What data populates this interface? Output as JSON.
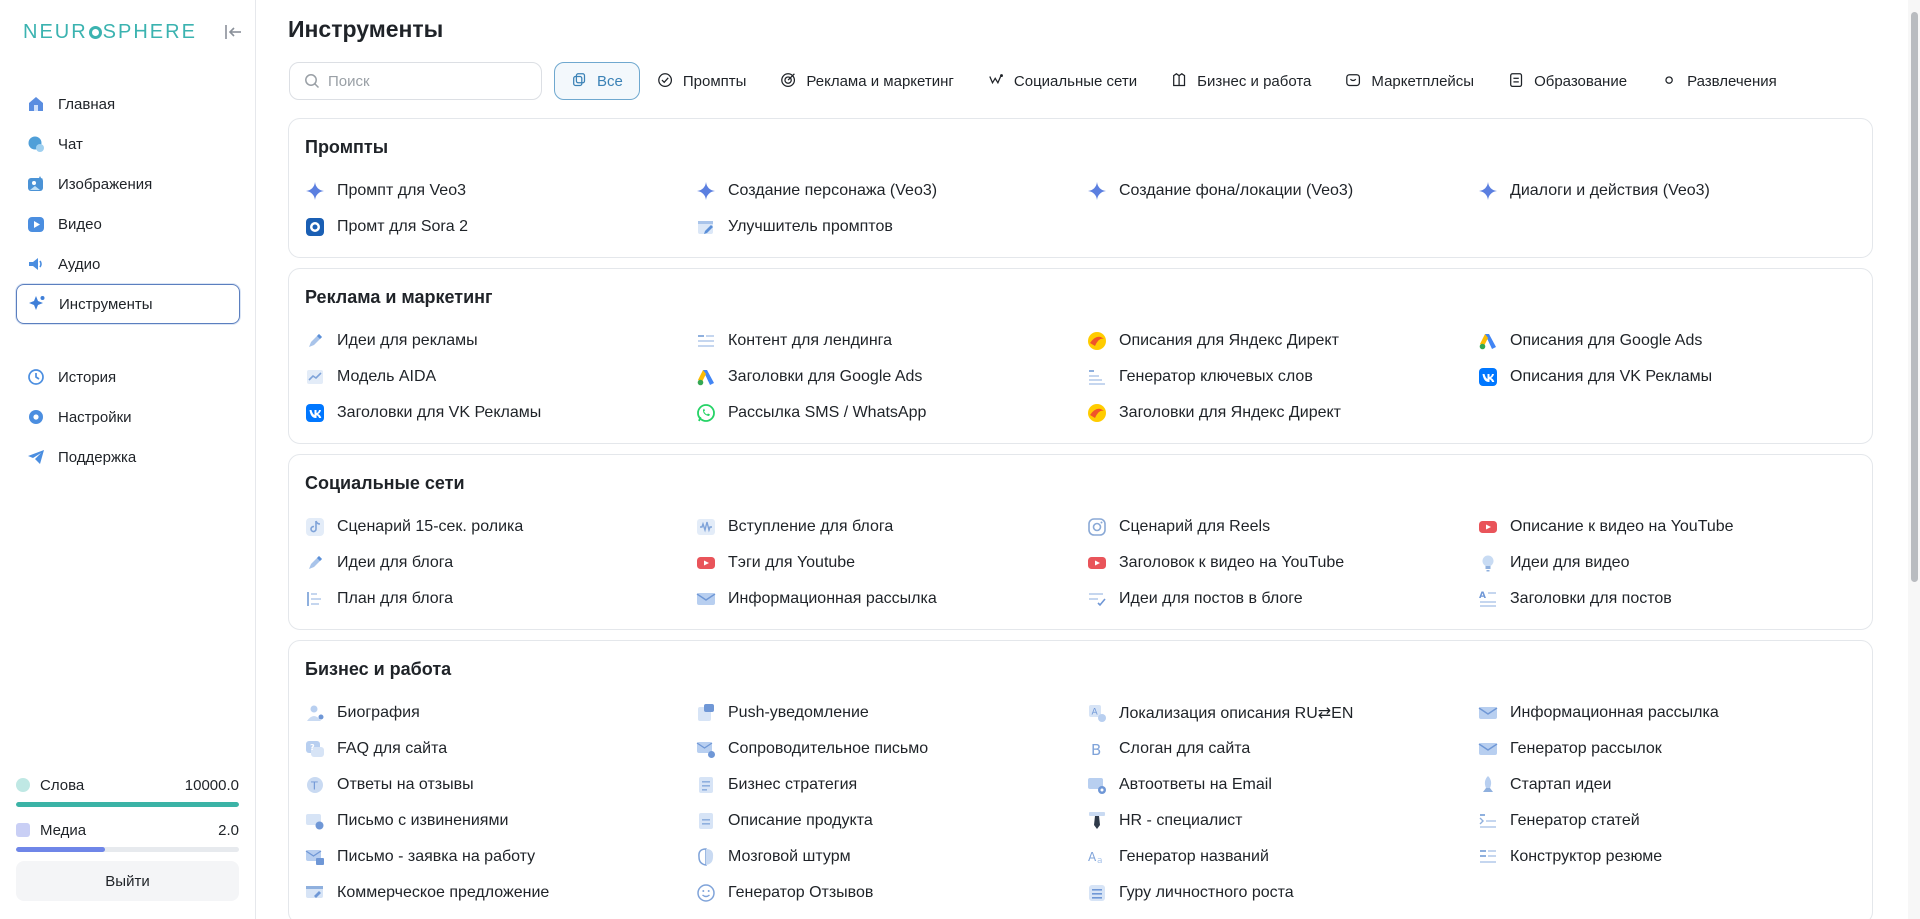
{
  "brand": {
    "logo_left": "NEUR",
    "logo_right": "SPHERE"
  },
  "nav": {
    "items": [
      {
        "label": "Главная",
        "icon": "home-icon"
      },
      {
        "label": "Чат",
        "icon": "chat-icon"
      },
      {
        "label": "Изображения",
        "icon": "image-icon"
      },
      {
        "label": "Видео",
        "icon": "video-icon"
      },
      {
        "label": "Аудио",
        "icon": "audio-icon"
      },
      {
        "label": "Инструменты",
        "icon": "sparkle-icon",
        "active": true
      }
    ],
    "secondary": [
      {
        "label": "История",
        "icon": "history-icon"
      },
      {
        "label": "Настройки",
        "icon": "gear-icon"
      },
      {
        "label": "Поддержка",
        "icon": "telegram-icon"
      }
    ]
  },
  "credits": {
    "words_label": "Слова",
    "words_value": "10000.0",
    "words_fill": 1.0,
    "media_label": "Медиа",
    "media_value": "2.0",
    "media_fill": 0.4
  },
  "logout_label": "Выйти",
  "page_title": "Инструменты",
  "search": {
    "placeholder": "Поиск"
  },
  "filters": [
    {
      "label": "Все",
      "active": true
    },
    {
      "label": "Промпты"
    },
    {
      "label": "Реклама и маркетинг"
    },
    {
      "label": "Социальные сети"
    },
    {
      "label": "Бизнес и работа"
    },
    {
      "label": "Маркетплейсы"
    },
    {
      "label": "Образование"
    },
    {
      "label": "Развлечения"
    }
  ],
  "sections": [
    {
      "title": "Промпты",
      "items": [
        {
          "label": "Промпт для Veo3",
          "icon": "gemini-star-icon"
        },
        {
          "label": "Создание персонажа (Veo3)",
          "icon": "gemini-star-icon"
        },
        {
          "label": "Создание фона/локации (Veo3)",
          "icon": "gemini-star-icon"
        },
        {
          "label": "Диалоги и действия (Veo3)",
          "icon": "gemini-star-icon"
        },
        {
          "label": "Промт для Sora 2",
          "icon": "sora-icon"
        },
        {
          "label": "Улучшитель промптов",
          "icon": "edit-window-icon"
        }
      ]
    },
    {
      "title": "Реклама и маркетинг",
      "items": [
        {
          "label": "Идеи для рекламы",
          "icon": "pen-icon"
        },
        {
          "label": "Контент для лендинга",
          "icon": "text-lines-icon"
        },
        {
          "label": "Описания для Яндекс Директ",
          "icon": "yandex-direct-icon"
        },
        {
          "label": "Описания для Google Ads",
          "icon": "google-ads-icon"
        },
        {
          "label": "Модель AIDA",
          "icon": "chart-line-icon"
        },
        {
          "label": "Заголовки для Google Ads",
          "icon": "google-ads-icon"
        },
        {
          "label": "Генератор ключевых слов",
          "icon": "list-icon"
        },
        {
          "label": "Описания для VK Рекламы",
          "icon": "vk-icon"
        },
        {
          "label": "Заголовки для VK Рекламы",
          "icon": "vk-icon"
        },
        {
          "label": "Рассылка SMS / WhatsApp",
          "icon": "whatsapp-icon"
        },
        {
          "label": "Заголовки для Яндекс Директ",
          "icon": "yandex-direct-icon"
        }
      ]
    },
    {
      "title": "Социальные сети",
      "items": [
        {
          "label": "Сценарий 15-сек. ролика",
          "icon": "tiktok-icon"
        },
        {
          "label": "Вступление для блога",
          "icon": "audio-wave-icon"
        },
        {
          "label": "Сценарий для Reels",
          "icon": "instagram-icon"
        },
        {
          "label": "Описание к видео на YouTube",
          "icon": "youtube-icon"
        },
        {
          "label": "Идеи для блога",
          "icon": "pen-icon"
        },
        {
          "label": "Тэги для Youtube",
          "icon": "youtube-icon"
        },
        {
          "label": "Заголовок к видео на YouTube",
          "icon": "youtube-icon"
        },
        {
          "label": "Идеи для видео",
          "icon": "lightbulb-icon"
        },
        {
          "label": "План для блога",
          "icon": "outline-icon"
        },
        {
          "label": "Информационная рассылка",
          "icon": "mail-icon"
        },
        {
          "label": "Идеи для постов в блоге",
          "icon": "checklist-icon"
        },
        {
          "label": "Заголовки для постов",
          "icon": "heading-icon"
        }
      ]
    },
    {
      "title": "Бизнес и работа",
      "items": [
        {
          "label": "Биография",
          "icon": "user-icon"
        },
        {
          "label": "Push-уведомление",
          "icon": "push-icon"
        },
        {
          "label": "Локализация описания RU⇄EN",
          "icon": "translate-icon"
        },
        {
          "label": "Информационная рассылка",
          "icon": "mail-icon"
        },
        {
          "label": "FAQ для сайта",
          "icon": "faq-icon"
        },
        {
          "label": "Сопроводительное письмо",
          "icon": "mail-plus-icon"
        },
        {
          "label": "Слоган для сайта",
          "icon": "bold-b-icon"
        },
        {
          "label": "Генератор рассылок",
          "icon": "mail-icon"
        },
        {
          "label": "Ответы на отзывы",
          "icon": "reply-icon"
        },
        {
          "label": "Бизнес стратегия",
          "icon": "document-icon"
        },
        {
          "label": "Автоответы на Email",
          "icon": "mail-auto-icon"
        },
        {
          "label": "Стартап идеи",
          "icon": "rocket-icon"
        },
        {
          "label": "Письмо с извинениями",
          "icon": "mail-apology-icon"
        },
        {
          "label": "Описание продукта",
          "icon": "product-icon"
        },
        {
          "label": "HR - специалист",
          "icon": "tie-icon"
        },
        {
          "label": "Генератор статей",
          "icon": "article-icon"
        },
        {
          "label": "Письмо - заявка на работу",
          "icon": "mail-job-icon"
        },
        {
          "label": "Мозговой штурм",
          "icon": "brain-icon"
        },
        {
          "label": "Генератор названий",
          "icon": "font-icon"
        },
        {
          "label": "Конструктор резюме",
          "icon": "resume-icon"
        },
        {
          "label": "Коммерческое предложение",
          "icon": "offer-icon"
        },
        {
          "label": "Генератор Отзывов",
          "icon": "smile-icon"
        },
        {
          "label": "Гуру личностного роста",
          "icon": "growth-icon"
        }
      ]
    }
  ]
}
